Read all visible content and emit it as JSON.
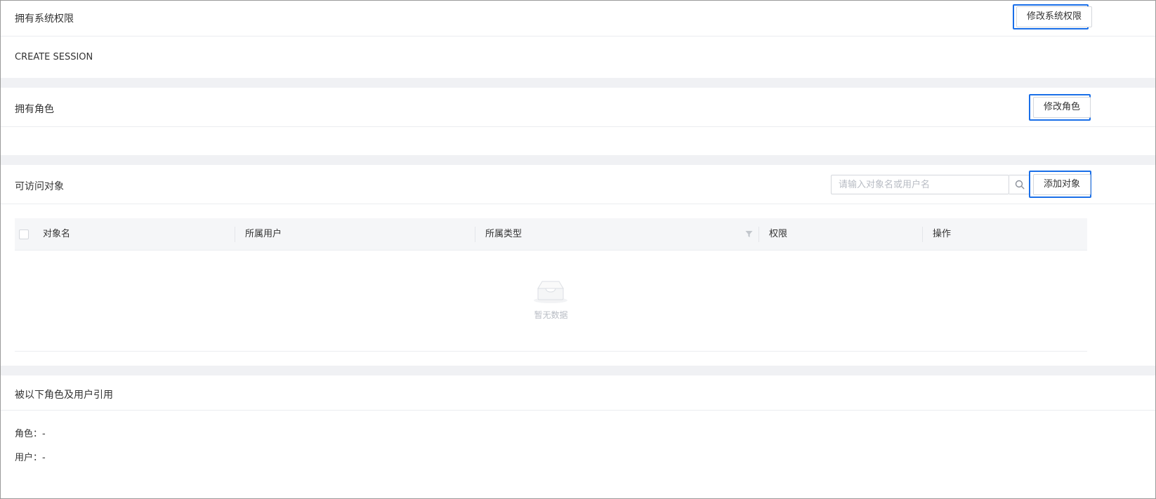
{
  "system_permissions": {
    "title": "拥有系统权限",
    "edit_button": "修改系统权限",
    "items": [
      "CREATE SESSION"
    ]
  },
  "roles": {
    "title": "拥有角色",
    "edit_button": "修改角色"
  },
  "accessible_objects": {
    "title": "可访问对象",
    "search_placeholder": "请输入对象名或用户名",
    "search_value": "",
    "add_button": "添加对象",
    "columns": [
      "对象名",
      "所属用户",
      "所属类型",
      "权限",
      "操作"
    ],
    "rows": [],
    "empty_text": "暂无数据"
  },
  "references": {
    "title": "被以下角色及用户引用",
    "role_label": "角色：",
    "role_value": "-",
    "user_label": "用户：",
    "user_value": "-"
  },
  "icons": {
    "search": "search-icon",
    "filter": "filter-icon",
    "empty": "empty-inbox-icon"
  },
  "colors": {
    "focus": "#1a6fe8",
    "section_gap": "#f0f1f4",
    "table_header": "#f5f6f8"
  }
}
